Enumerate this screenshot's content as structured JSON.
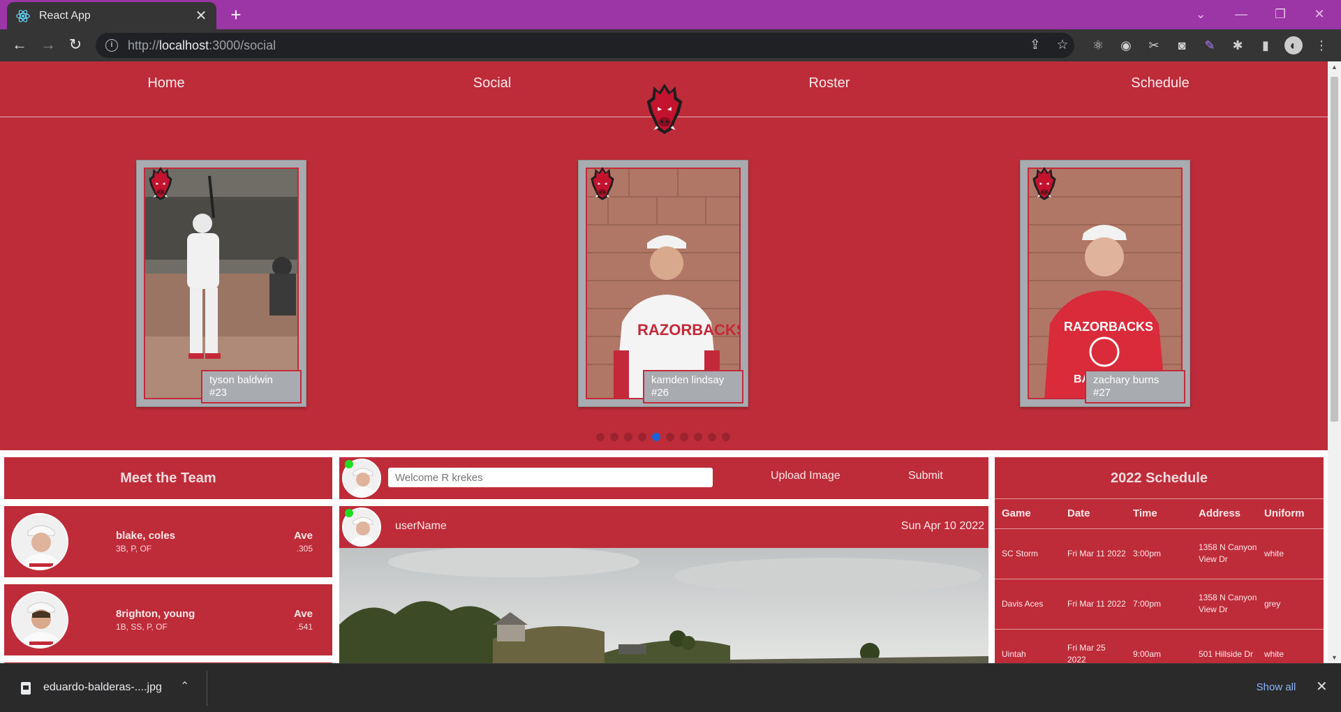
{
  "browser": {
    "tab_title": "React App",
    "url_prefix": "http://",
    "url_host": "localhost",
    "url_rest": ":3000/social"
  },
  "nav": {
    "home": "Home",
    "social": "Social",
    "roster": "Roster",
    "schedule": "Schedule"
  },
  "carousel": {
    "cards": [
      {
        "name": "tyson baldwin",
        "number": "#23"
      },
      {
        "name": "kamden lindsay",
        "number": "#26"
      },
      {
        "name": "zachary burns",
        "number": "#27"
      }
    ],
    "dot_count": 10,
    "active_dot": 4
  },
  "team": {
    "title": "Meet the Team",
    "players": [
      {
        "name": "blake, coles",
        "positions": "3B, P, OF",
        "ave_label": "Ave",
        "ave": ".305"
      },
      {
        "name": "8righton, young",
        "positions": "1B, SS, P, OF",
        "ave_label": "Ave",
        "ave": ".541"
      }
    ]
  },
  "post_composer": {
    "placeholder": "Welcome R krekes",
    "upload_label": "Upload Image",
    "submit_label": "Submit"
  },
  "post": {
    "user": "userName",
    "date": "Sun Apr 10 2022"
  },
  "schedule": {
    "title": "2022 Schedule",
    "columns": [
      "Game",
      "Date",
      "Time",
      "Address",
      "Uniform"
    ],
    "rows": [
      {
        "game": "SC Storm",
        "date": "Fri Mar 11 2022",
        "time": "3:00pm",
        "address": "1358 N Canyon View Dr",
        "uniform": "white"
      },
      {
        "game": "Davis Aces",
        "date": "Fri Mar 11 2022",
        "time": "7:00pm",
        "address": "1358 N Canyon View Dr",
        "uniform": "grey"
      },
      {
        "game": "Uintah",
        "date": "Fri Mar 25 2022",
        "time": "9:00am",
        "address": "501 Hillside Dr",
        "uniform": "white"
      }
    ]
  },
  "downloads": {
    "file_name": "eduardo-balderas-....jpg",
    "show_all": "Show all"
  },
  "colors": {
    "brand_red": "#be2c39",
    "tab_purple": "#9c35a5",
    "active_dot": "#1a63d6"
  }
}
